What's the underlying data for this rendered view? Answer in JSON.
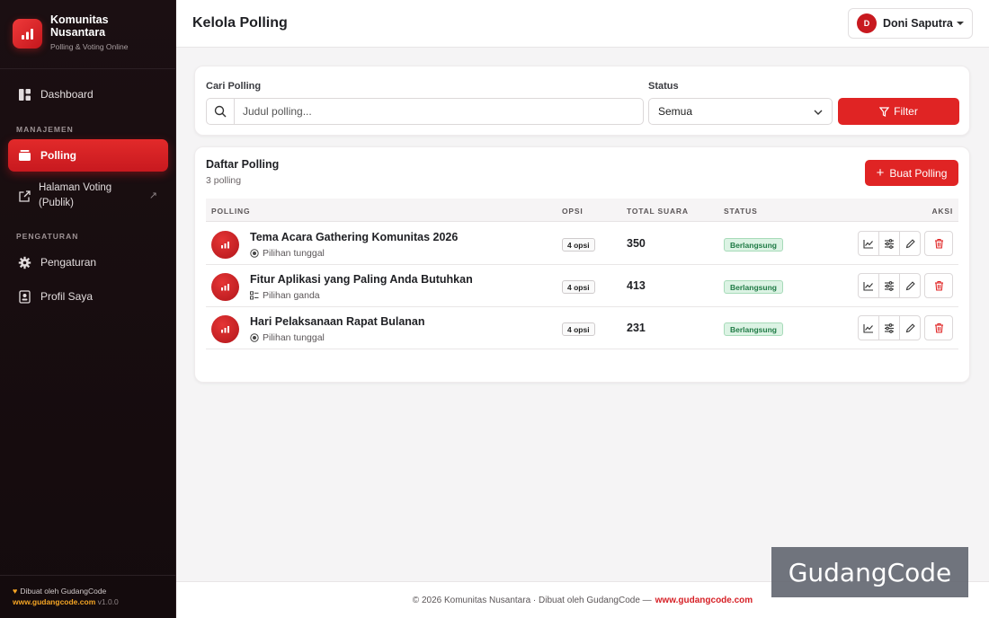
{
  "brand": {
    "name_line1": "Komunitas",
    "name_line2": "Nusantara",
    "tagline": "Polling & Voting Online"
  },
  "sidebar": {
    "dashboard": "Dashboard",
    "section_manage": "MANAJEMEN",
    "polling": "Polling",
    "public_voting_line1": "Halaman Voting",
    "public_voting_line2": "(Publik)",
    "section_settings": "PENGATURAN",
    "settings": "Pengaturan",
    "profile": "Profil Saya",
    "footer_made": "Dibuat oleh GudangCode",
    "footer_url": "www.gudangcode.com",
    "footer_version": "v1.0.0"
  },
  "header": {
    "title": "Kelola Polling",
    "user_initial": "D",
    "user_name": "Doni Saputra"
  },
  "filters": {
    "search_label": "Cari Polling",
    "search_placeholder": "Judul polling...",
    "status_label": "Status",
    "status_value": "Semua",
    "filter_button": "Filter"
  },
  "list": {
    "title": "Daftar Polling",
    "count": "3 polling",
    "create_button": "Buat Polling",
    "columns": {
      "polling": "POLLING",
      "options": "OPSI",
      "votes": "TOTAL SUARA",
      "status": "STATUS",
      "actions": "AKSI"
    },
    "rows": [
      {
        "title": "Tema Acara Gathering Komunitas 2026",
        "type": "Pilihan tunggal",
        "type_icon": "radio-icon",
        "options": "4 opsi",
        "votes": "350",
        "status": "Berlangsung"
      },
      {
        "title": "Fitur Aplikasi yang Paling Anda Butuhkan",
        "type": "Pilihan ganda",
        "type_icon": "checklist-icon",
        "options": "4 opsi",
        "votes": "413",
        "status": "Berlangsung"
      },
      {
        "title": "Hari Pelaksanaan Rapat Bulanan",
        "type": "Pilihan tunggal",
        "type_icon": "radio-icon",
        "options": "4 opsi",
        "votes": "231",
        "status": "Berlangsung"
      }
    ]
  },
  "footer": {
    "text": "© 2026 Komunitas Nusantara · Dibuat oleh GudangCode —",
    "link": "www.gudangcode.com"
  },
  "watermark": "GudangCode",
  "colors": {
    "accent": "#e02424",
    "sidebar_bg": "#1b0f12",
    "status_bg": "#dcf3e4",
    "status_text": "#1f7a45",
    "footer_link": "#f5a524"
  }
}
